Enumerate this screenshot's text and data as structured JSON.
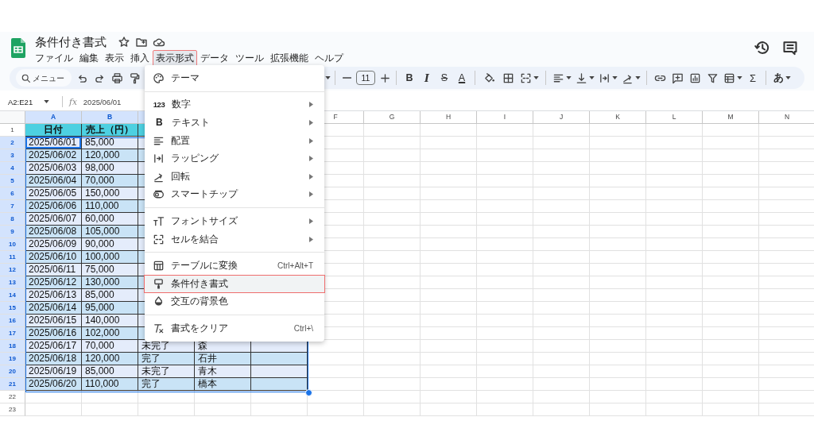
{
  "document": {
    "title": "条件付き書式"
  },
  "menu_bar": [
    {
      "label": "ファイル",
      "selected": false
    },
    {
      "label": "編集",
      "selected": false
    },
    {
      "label": "表示",
      "selected": false
    },
    {
      "label": "挿入",
      "selected": false
    },
    {
      "label": "表示形式",
      "selected": true
    },
    {
      "label": "データ",
      "selected": false
    },
    {
      "label": "ツール",
      "selected": false
    },
    {
      "label": "拡張機能",
      "selected": false
    },
    {
      "label": "ヘルプ",
      "selected": false
    }
  ],
  "toolbar": {
    "search_placeholder": "メニュー",
    "font_size": "11",
    "bold": "B",
    "italic": "I",
    "strikethrough": "S",
    "text_color": "A",
    "sum": "Σ",
    "input_mode": "あ"
  },
  "formula_bar": {
    "name_box": "A2:E21",
    "function_label": "fx",
    "value": "2025/06/01"
  },
  "sheet": {
    "columns": [
      {
        "label": "A",
        "selected": true
      },
      {
        "label": "B",
        "selected": true
      },
      {
        "selected": true
      },
      {},
      {},
      {
        "label": "F",
        "selected": false
      },
      {
        "label": "G",
        "selected": false
      },
      {
        "label": "H",
        "selected": false
      },
      {
        "label": "I",
        "selected": false
      },
      {
        "label": "J",
        "selected": false
      },
      {
        "label": "K",
        "selected": false
      },
      {
        "label": "L",
        "selected": false
      },
      {
        "label": "M",
        "selected": false
      },
      {
        "label": "N",
        "selected": false
      }
    ],
    "rows": [
      {
        "number": "1",
        "selected": false,
        "color": "#4dd0e1",
        "cells": [
          "日付",
          "売上（円）"
        ]
      },
      {
        "number": "2",
        "selected": true,
        "color": "#e4ecfb",
        "cells": [
          "2025/06/01",
          "85,000"
        ]
      },
      {
        "number": "3",
        "selected": true,
        "color": "#c9e3f6",
        "cells": [
          "2025/06/02",
          "120,000"
        ]
      },
      {
        "number": "4",
        "selected": true,
        "color": "#e4ecfb",
        "cells": [
          "2025/06/03",
          "98,000"
        ]
      },
      {
        "number": "5",
        "selected": true,
        "color": "#c9e3f6",
        "cells": [
          "2025/06/04",
          "70,000"
        ]
      },
      {
        "number": "6",
        "selected": true,
        "color": "#e4ecfb",
        "cells": [
          "2025/06/05",
          "150,000"
        ]
      },
      {
        "number": "7",
        "selected": true,
        "color": "#c9e3f6",
        "cells": [
          "2025/06/06",
          "110,000"
        ]
      },
      {
        "number": "8",
        "selected": true,
        "color": "#e4ecfb",
        "cells": [
          "2025/06/07",
          "60,000"
        ]
      },
      {
        "number": "9",
        "selected": true,
        "color": "#c9e3f6",
        "cells": [
          "2025/06/08",
          "105,000"
        ]
      },
      {
        "number": "10",
        "selected": true,
        "color": "#e4ecfb",
        "cells": [
          "2025/06/09",
          "90,000"
        ]
      },
      {
        "number": "11",
        "selected": true,
        "color": "#c9e3f6",
        "cells": [
          "2025/06/10",
          "100,000"
        ]
      },
      {
        "number": "12",
        "selected": true,
        "color": "#e4ecfb",
        "cells": [
          "2025/06/11",
          "75,000"
        ]
      },
      {
        "number": "13",
        "selected": true,
        "color": "#c9e3f6",
        "cells": [
          "2025/06/12",
          "130,000"
        ]
      },
      {
        "number": "14",
        "selected": true,
        "color": "#e4ecfb",
        "cells": [
          "2025/06/13",
          "85,000"
        ]
      },
      {
        "number": "15",
        "selected": true,
        "color": "#c9e3f6",
        "cells": [
          "2025/06/14",
          "95,000"
        ]
      },
      {
        "number": "16",
        "selected": true,
        "color": "#e4ecfb",
        "cells": [
          "2025/06/15",
          "140,000"
        ]
      },
      {
        "number": "17",
        "selected": true,
        "color": "#c9e3f6",
        "cells": [
          "2025/06/16",
          "102,000"
        ]
      },
      {
        "number": "18",
        "selected": true,
        "color": "#e4ecfb",
        "cells": [
          "2025/06/17",
          "70,000",
          "未完了",
          "森"
        ]
      },
      {
        "number": "19",
        "selected": true,
        "color": "#c9e3f6",
        "cells": [
          "2025/06/18",
          "120,000",
          "完了",
          "石井"
        ]
      },
      {
        "number": "20",
        "selected": true,
        "color": "#e4ecfb",
        "cells": [
          "2025/06/19",
          "85,000",
          "未完了",
          "青木"
        ]
      },
      {
        "number": "21",
        "selected": true,
        "color": "#c9e3f6",
        "cells": [
          "2025/06/20",
          "110,000",
          "完了",
          "橋本"
        ]
      },
      {
        "number": "22",
        "selected": false
      },
      {
        "number": "23",
        "selected": false
      }
    ]
  },
  "format_menu": {
    "items": [
      {
        "kind": "item",
        "label": "テーマ",
        "submenu": false,
        "selected": false
      },
      {
        "kind": "divider"
      },
      {
        "kind": "item",
        "glyph": "123",
        "label": "数字",
        "submenu": true,
        "selected": false
      },
      {
        "kind": "item",
        "glyph": "B",
        "label": "テキスト",
        "submenu": true,
        "selected": false
      },
      {
        "kind": "item",
        "label": "配置",
        "submenu": true,
        "selected": false
      },
      {
        "kind": "item",
        "label": "ラッピング",
        "submenu": true,
        "selected": false
      },
      {
        "kind": "item",
        "label": "回転",
        "submenu": true,
        "selected": false
      },
      {
        "kind": "item",
        "label": "スマートチップ",
        "submenu": true,
        "selected": false
      },
      {
        "kind": "divider"
      },
      {
        "kind": "item",
        "label": "フォントサイズ",
        "submenu": true,
        "selected": false
      },
      {
        "kind": "item",
        "label": "セルを結合",
        "submenu": true,
        "selected": false
      },
      {
        "kind": "divider"
      },
      {
        "kind": "item",
        "label": "テーブルに変換",
        "shortcut": "Ctrl+Alt+T",
        "submenu": false,
        "selected": false
      },
      {
        "kind": "item",
        "label": "条件付き書式",
        "submenu": false,
        "selected": true
      },
      {
        "kind": "item",
        "label": "交互の背景色",
        "submenu": false,
        "selected": false
      },
      {
        "kind": "divider"
      },
      {
        "kind": "item",
        "label": "書式をクリア",
        "shortcut": "Ctrl+\\",
        "submenu": false,
        "selected": false
      }
    ]
  }
}
